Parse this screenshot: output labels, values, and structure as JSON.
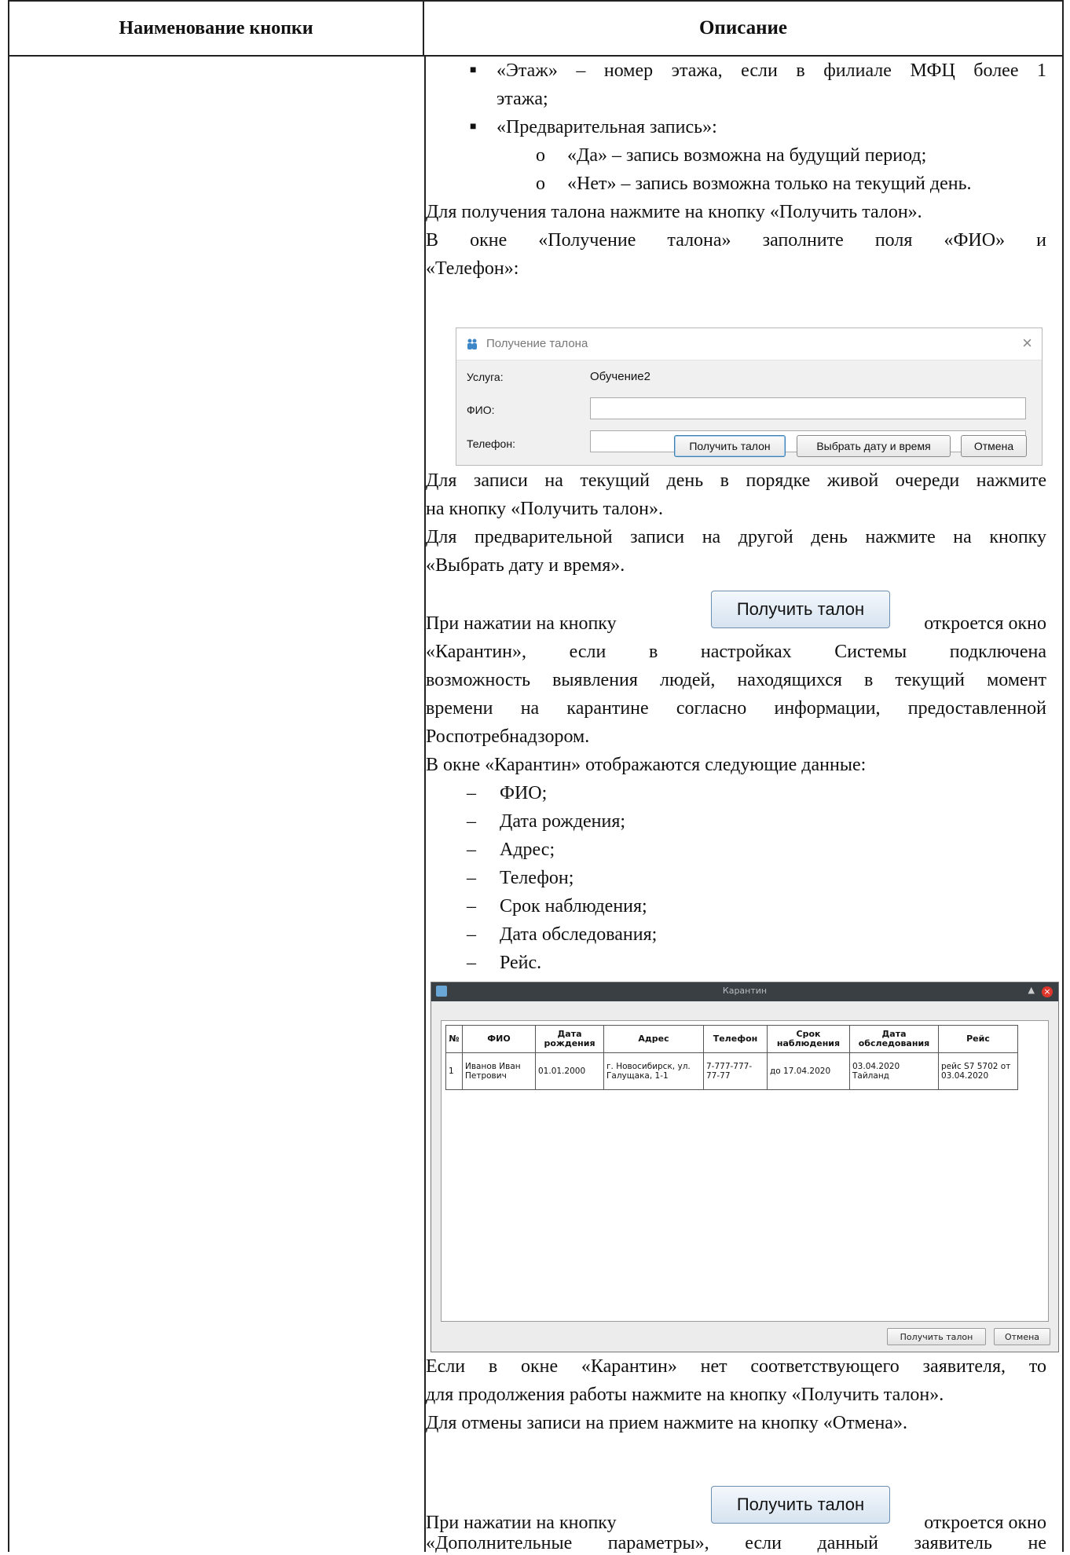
{
  "header": {
    "col1": "Наименование кнопки",
    "col2": "Описание"
  },
  "content": {
    "b_floor_1": "«Этаж» – номер этажа, если в филиале МФЦ более 1",
    "b_floor_2": "этажа;",
    "b_prereg": "«Предварительная запись»:",
    "o_yes": "«Да» – запись возможна на будущий период;",
    "o_no": "«Нет» – запись возможна только на текущий день.",
    "p_get_ticket": "Для получения талона нажмите на кнопку «Получить талон».",
    "p_window_1": "В окне «Получение талона» заполните поля «ФИО» и",
    "p_window_2": "«Телефон»:",
    "p_live_1": "Для записи на текущий день в порядке живой очереди нажмите",
    "p_live_2": "на кнопку «Получить талон».",
    "p_other_1": "Для предварительной записи на другой день нажмите на кнопку",
    "p_other_2": "«Выбрать дату и время».",
    "p_press_a": "При нажатии на кнопку",
    "p_press_b": "откроется окно",
    "p_quar_1": "«Карантин», если в настройках Системы подключена",
    "p_quar_2": "возможность выявления людей, находящихся в текущий момент",
    "p_quar_3": "времени на карантине согласно информации, предоставленной",
    "p_quar_4": "Роспотребнадзором.",
    "p_quar_data": "В окне «Карантин» отображаются следующие данные:",
    "list": [
      "ФИО;",
      "Дата рождения;",
      "Адрес;",
      "Телефон;",
      "Срок наблюдения;",
      "Дата обследования;",
      "Рейс."
    ],
    "p_none_1": "Если в окне «Карантин» нет соответствующего заявителя, то",
    "p_none_2": "для продолжения работы нажмите на кнопку «Получить талон».",
    "p_cancel": "Для отмены записи на прием нажмите на кнопку «Отмена».",
    "p_press2_a": "При нажатии на кнопку",
    "p_press2_b": "откроется окно",
    "p_extra": "«Дополнительные параметры», если данный заявитель не"
  },
  "dialog1": {
    "title": "Получение талона",
    "service_label": "Услуга:",
    "service_value": "Обучение2",
    "fio_label": "ФИО:",
    "phone_label": "Телефон:",
    "btn_get": "Получить талон",
    "btn_choose": "Выбрать дату и время",
    "btn_cancel": "Отмена"
  },
  "big_button": {
    "label": "Получить талон"
  },
  "quarantine": {
    "title": "Карантин",
    "columns": [
      "№",
      "ФИО",
      "Дата рождения",
      "Адрес",
      "Телефон",
      "Срок наблюдения",
      "Дата обследования",
      "Рейс"
    ],
    "row": [
      "1",
      "Иванов Иван Петрович",
      "01.01.2000",
      "г. Новосибирск, ул. Галущака, 1-1",
      "7-777-777-77-77",
      "до 17.04.2020",
      "03.04.2020 Тайланд",
      "рейс S7 5702 от 03.04.2020"
    ],
    "btn_get": "Получить талон",
    "btn_cancel": "Отмена"
  }
}
